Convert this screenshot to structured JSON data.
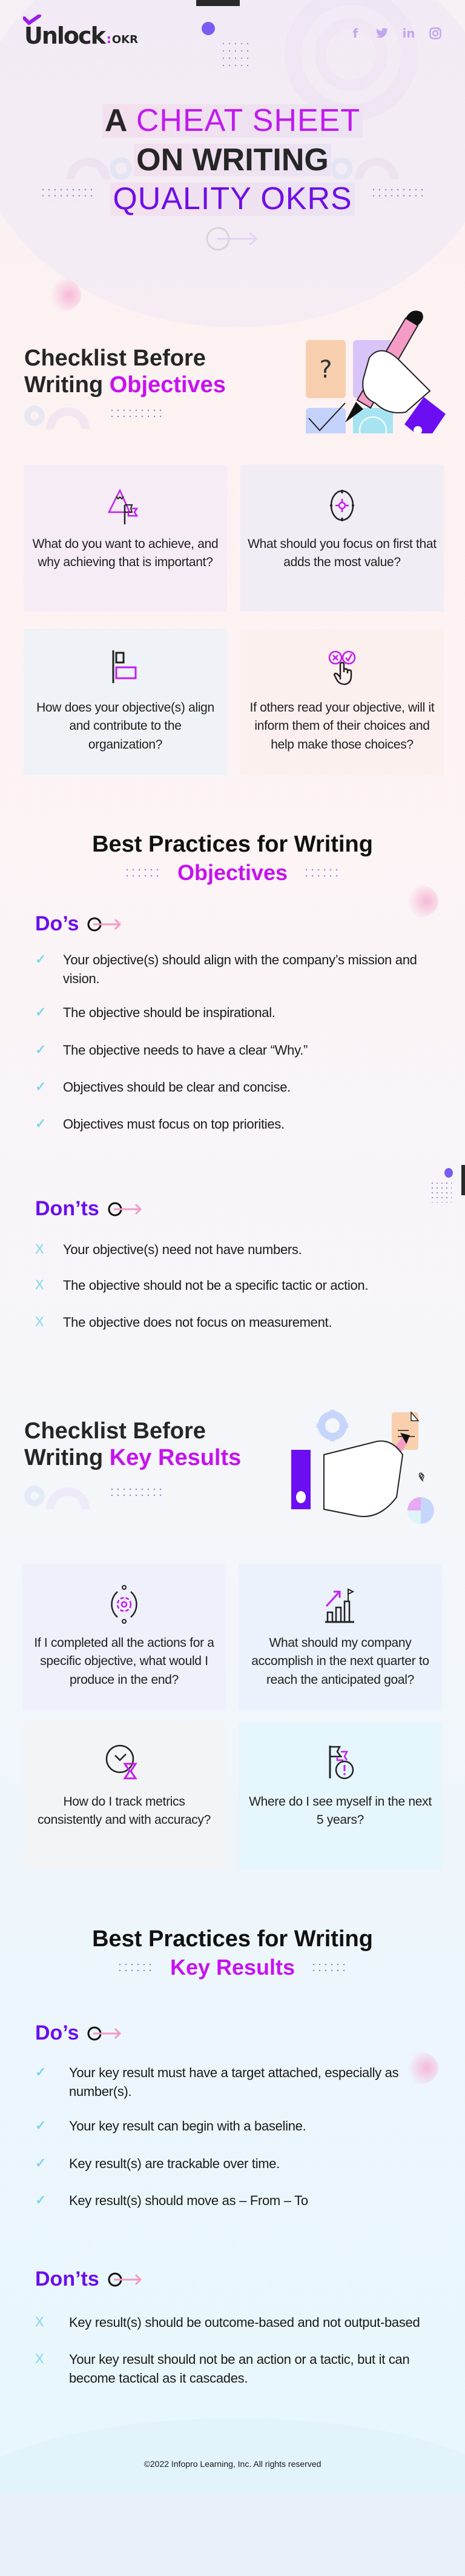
{
  "brand": {
    "logo_main": "Unlock",
    "logo_sep": ":",
    "logo_suffix": "OKR"
  },
  "socials": [
    {
      "name": "facebook",
      "glyph": "f"
    },
    {
      "name": "twitter",
      "glyph": "🐦"
    },
    {
      "name": "linkedin",
      "glyph": "in"
    },
    {
      "name": "instagram",
      "glyph": "◎"
    }
  ],
  "hero": {
    "line1_a": "A",
    "line1_b": "CHEAT SHEET",
    "line2": "ON WRITING",
    "line3": "QUALITY OKRS"
  },
  "objectives_checklist": {
    "title_a": "Checklist Before",
    "title_b": "Writing",
    "title_accent": "Objectives",
    "cards": [
      {
        "icon": "mountain-flag-icon",
        "text": "What do you want to achieve, and why achieving that is important?"
      },
      {
        "icon": "crosshair-target-icon",
        "text": "What should you focus on first that adds the most value?"
      },
      {
        "icon": "align-left-icon",
        "text": "How does your objective(s) align and contribute to the organization?"
      },
      {
        "icon": "choice-hand-icon",
        "text": "If others read your objective, will it inform them of their choices and help make those choices?"
      }
    ]
  },
  "objectives_best": {
    "title_a": "Best Practices for Writing",
    "title_b": "Objectives",
    "dos_label": "Do’s",
    "dos": [
      "Your objective(s) should align with the company’s mission and vision.",
      "The objective should be inspirational.",
      "The objective needs to have a clear “Why.”",
      "Objectives should be clear and concise.",
      "Objectives must focus on top priorities."
    ],
    "donts_label": "Don’ts",
    "donts": [
      "Your objective(s) need not have numbers.",
      "The objective should not be a specific tactic or action.",
      "The objective does not focus on measurement."
    ]
  },
  "kr_checklist": {
    "title_a": "Checklist Before",
    "title_b": "Writing",
    "title_accent": "Key Results",
    "cards": [
      {
        "icon": "gear-cycle-icon",
        "text": "If I completed all the actions for a specific objective, what would I produce in the end?"
      },
      {
        "icon": "growth-chart-flag-icon",
        "text": "What should my company accomplish in the next quarter to reach the anticipated goal?"
      },
      {
        "icon": "clock-hourglass-icon",
        "text": "How do I track metrics consistently and with accuracy?"
      },
      {
        "icon": "flag-alert-icon",
        "text": "Where do I see myself in the next 5 years?"
      }
    ]
  },
  "kr_best": {
    "title_a": "Best Practices for Writing",
    "title_b": "Key Results",
    "dos_label": "Do’s",
    "dos": [
      "Your key result must have a target attached, especially as number(s).",
      "Your key result can begin with a baseline.",
      "Key result(s) are trackable over time.",
      "Key result(s) should move as – From – To"
    ],
    "donts_label": "Don’ts",
    "donts": [
      "Key result(s) should be outcome-based and not output-based",
      "Your key result should not be an action or a tactic, but it can become tactical as it cascades."
    ]
  },
  "marks": {
    "do": "✓",
    "dont": "X"
  },
  "footer": {
    "copyright": "©2022 Infopro Learning, Inc. All rights reserved"
  },
  "colors": {
    "accent_magenta": "#c612ef",
    "accent_violet": "#6a0ef0",
    "check_cyan": "#7fd6ea",
    "text_dark": "#262626"
  }
}
